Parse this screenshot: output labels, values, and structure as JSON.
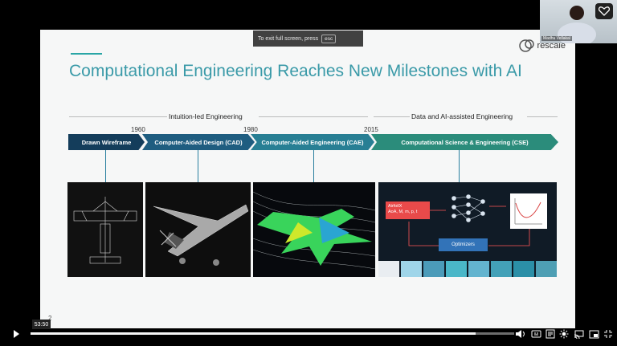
{
  "overlay": {
    "fullscreen_hint": "To exit full screen, press",
    "esc_key": "esc",
    "presenter_name": "Madhu Vellakal",
    "timestamp": "53:50",
    "progress": 0.92
  },
  "slide": {
    "title": "Computational Engineering Reaches New Milestones with AI",
    "logo_text": "rescale",
    "page_number": "2",
    "eras": [
      {
        "label": "Intuition-led Engineering"
      },
      {
        "label": "Data and AI-assisted Engineering"
      }
    ],
    "years": [
      "1960",
      "1980",
      "2015"
    ],
    "phases": [
      {
        "label": "Drawn Wireframe",
        "color": "#143d5b"
      },
      {
        "label": "Computer-Aided Design (CAD)",
        "color": "#1f5d80"
      },
      {
        "label": "Computer-Aided Engineering (CAE)",
        "color": "#287f94"
      },
      {
        "label": "Computational Science & Engineering (CSE)",
        "color": "#2b8c7b"
      }
    ],
    "cse_diagram": {
      "input_box": "AirfoilX\nAoA, M, m, p, t",
      "optimizer": "Optimizers"
    }
  }
}
